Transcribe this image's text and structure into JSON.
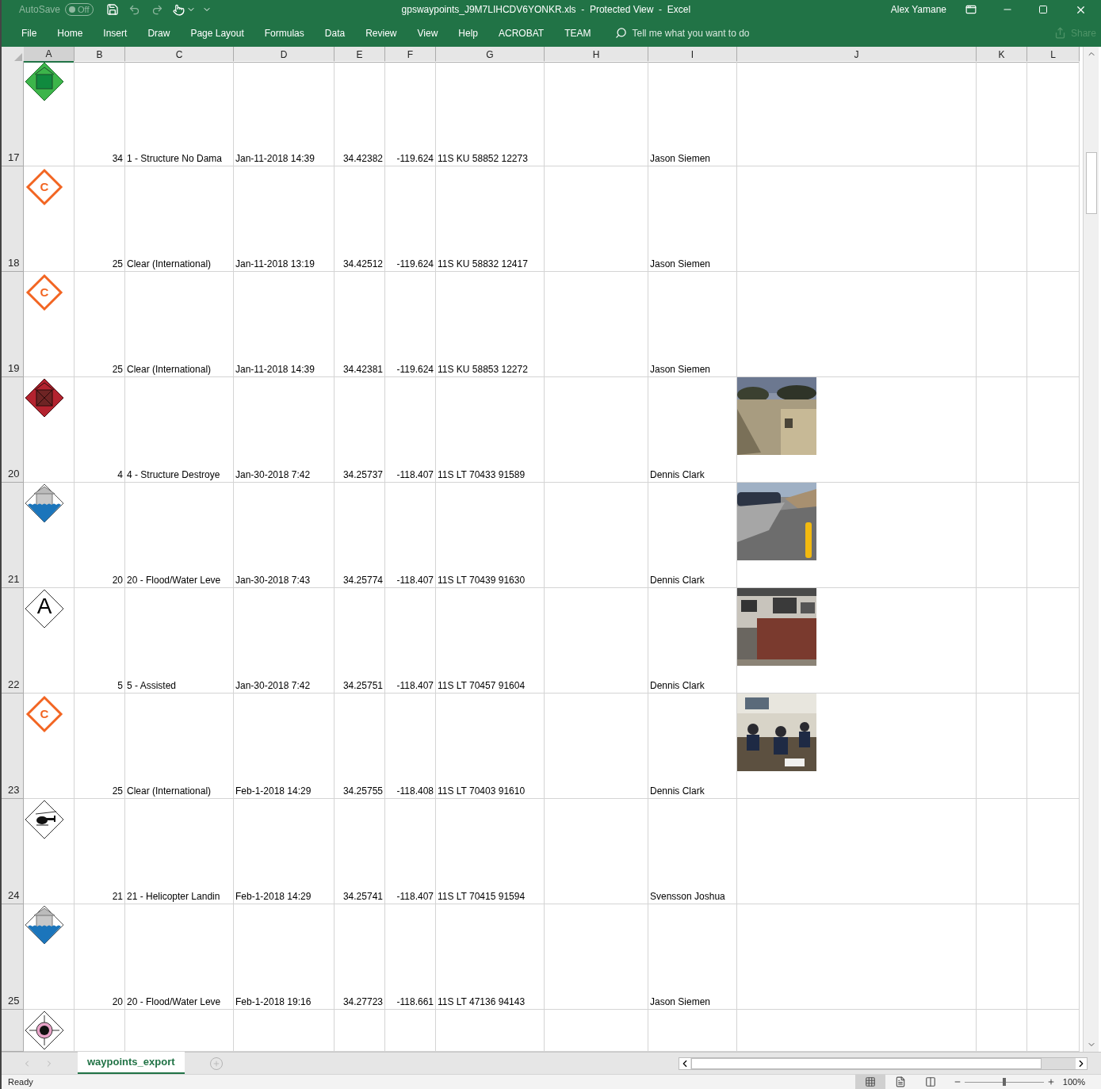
{
  "window": {
    "autosave": {
      "label": "AutoSave",
      "on": false,
      "state_text": "Off"
    },
    "title": "gpswaypoints_J9M7LIHCDV6YONKR.xls  -  Protected View  -  Excel",
    "user": "Alex Yamane"
  },
  "ribbon_tabs": [
    {
      "label": "File",
      "selected": false
    },
    {
      "label": "Home",
      "selected": false
    },
    {
      "label": "Insert",
      "selected": false
    },
    {
      "label": "Draw",
      "selected": false
    },
    {
      "label": "Page Layout",
      "selected": false
    },
    {
      "label": "Formulas",
      "selected": false
    },
    {
      "label": "Data",
      "selected": false
    },
    {
      "label": "Review",
      "selected": false
    },
    {
      "label": "View",
      "selected": false
    },
    {
      "label": "Help",
      "selected": false
    },
    {
      "label": "ACROBAT",
      "selected": false
    },
    {
      "label": "TEAM",
      "selected": false
    }
  ],
  "tell_me": {
    "placeholder": "Tell me what you want to do"
  },
  "share": {
    "label": "Share",
    "disabled": true
  },
  "columns": [
    {
      "label": "A",
      "selected": true
    },
    {
      "label": "B",
      "selected": false
    },
    {
      "label": "C",
      "selected": false
    },
    {
      "label": "D",
      "selected": false
    },
    {
      "label": "E",
      "selected": false
    },
    {
      "label": "F",
      "selected": false
    },
    {
      "label": "G",
      "selected": false
    },
    {
      "label": "H",
      "selected": false
    },
    {
      "label": "I",
      "selected": false
    },
    {
      "label": "J",
      "selected": false
    },
    {
      "label": "K",
      "selected": false
    },
    {
      "label": "L",
      "selected": false
    }
  ],
  "rows": [
    {
      "number": "17",
      "icon": {
        "kind": "structure-ok"
      },
      "cells": [
        "34",
        "1 - Structure No Dama",
        "Jan-11-2018 14:39",
        "34.42382",
        "-119.624",
        "11S KU 58852 12273",
        "Jason Siemen"
      ]
    },
    {
      "number": "18",
      "icon": {
        "kind": "letter-orange",
        "letter": "C"
      },
      "cells": [
        "25",
        "Clear (International)",
        "Jan-11-2018 13:19",
        "34.42512",
        "-119.624",
        "11S KU 58832 12417",
        "Jason Siemen"
      ]
    },
    {
      "number": "19",
      "icon": {
        "kind": "letter-orange",
        "letter": "C"
      },
      "cells": [
        "25",
        "Clear (International)",
        "Jan-11-2018 14:39",
        "34.42381",
        "-119.624",
        "11S KU 58853 12272",
        "Jason Siemen"
      ]
    },
    {
      "number": "20",
      "icon": {
        "kind": "structure-destroyed"
      },
      "cells": [
        "4",
        "4 - Structure Destroye",
        "Jan-30-2018 7:42",
        "34.25737",
        "-118.407",
        "11S LT 70433 91589",
        "Dennis Clark"
      ]
    },
    {
      "number": "21",
      "icon": {
        "kind": "flood"
      },
      "cells": [
        "20",
        "20 - Flood/Water Leve",
        "Jan-30-2018 7:43",
        "34.25774",
        "-118.407",
        "11S LT 70439 91630",
        "Dennis Clark"
      ]
    },
    {
      "number": "22",
      "icon": {
        "kind": "letter-black",
        "letter": "A"
      },
      "cells": [
        "5",
        "5 - Assisted",
        "Jan-30-2018 7:42",
        "34.25751",
        "-118.407",
        "11S LT 70457 91604",
        "Dennis Clark"
      ]
    },
    {
      "number": "23",
      "icon": {
        "kind": "letter-orange",
        "letter": "C"
      },
      "cells": [
        "25",
        "Clear (International)",
        "Feb-1-2018 14:29",
        "34.25755",
        "-118.408",
        "11S LT 70403 91610",
        "Dennis Clark"
      ]
    },
    {
      "number": "24",
      "icon": {
        "kind": "helicopter"
      },
      "cells": [
        "21",
        "21 - Helicopter Landin",
        "Feb-1-2018 14:29",
        "34.25741",
        "-118.407",
        "11S LT 70415 91594",
        "Svensson Joshua"
      ]
    },
    {
      "number": "25",
      "icon": {
        "kind": "flood"
      },
      "cells": [
        "20",
        "20 - Flood/Water Leve",
        "Feb-1-2018 19:16",
        "34.27723",
        "-118.661",
        "11S LT 47136 94143",
        "Jason Siemen"
      ]
    }
  ],
  "partial_row": {
    "icon": {
      "kind": "target"
    }
  },
  "sheet_tabs": [
    {
      "label": "waypoints_export",
      "selected": true
    }
  ],
  "status_bar": {
    "text": "Ready",
    "views": [
      {
        "kind": "normal",
        "selected": true
      },
      {
        "kind": "page-layout",
        "selected": false
      },
      {
        "kind": "page-break",
        "selected": false
      }
    ],
    "zoom": {
      "level": 0.5,
      "reading": "100%"
    }
  }
}
